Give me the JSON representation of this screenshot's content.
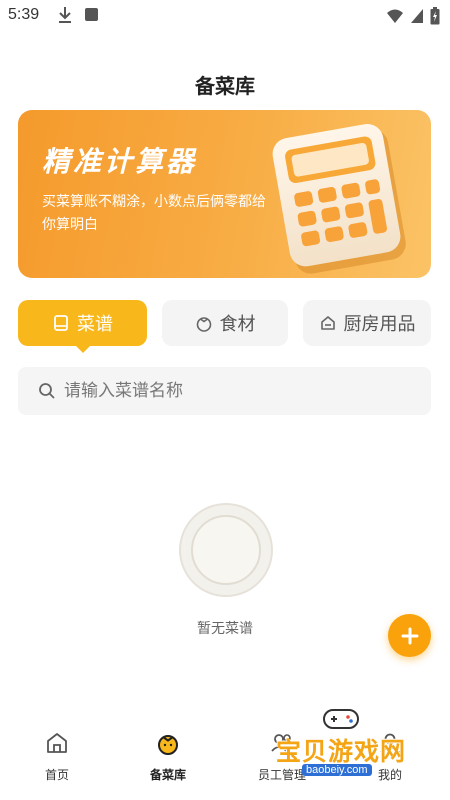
{
  "status_bar": {
    "time": "5:39",
    "icons": [
      "download-icon",
      "a-icon",
      "wifi-icon",
      "signal-icon",
      "battery-icon"
    ]
  },
  "page": {
    "title": "备菜库"
  },
  "banner": {
    "title": "精准计算器",
    "description": "买菜算账不糊涂，小数点后俩零都给你算明白"
  },
  "tabs": [
    {
      "label": "菜谱",
      "icon": "book-icon",
      "active": true
    },
    {
      "label": "食材",
      "icon": "tomato-icon",
      "active": false
    },
    {
      "label": "厨房用品",
      "icon": "house-icon",
      "active": false
    }
  ],
  "search": {
    "placeholder": "请输入菜谱名称",
    "value": ""
  },
  "empty_state": {
    "text": "暂无菜谱"
  },
  "bottom_nav": [
    {
      "label": "首页",
      "icon": "home-icon",
      "active": false
    },
    {
      "label": "备菜库",
      "icon": "tomato-icon",
      "active": true
    },
    {
      "label": "员工管理",
      "icon": "people-icon",
      "active": false
    },
    {
      "label": "我的",
      "icon": "user-icon",
      "active": false
    }
  ],
  "watermark": {
    "text": "宝贝游戏网",
    "url": "baobeiy.com"
  },
  "colors": {
    "accent": "#f8b81c",
    "fab": "#f9a20b",
    "banner": "#f59a2c"
  }
}
